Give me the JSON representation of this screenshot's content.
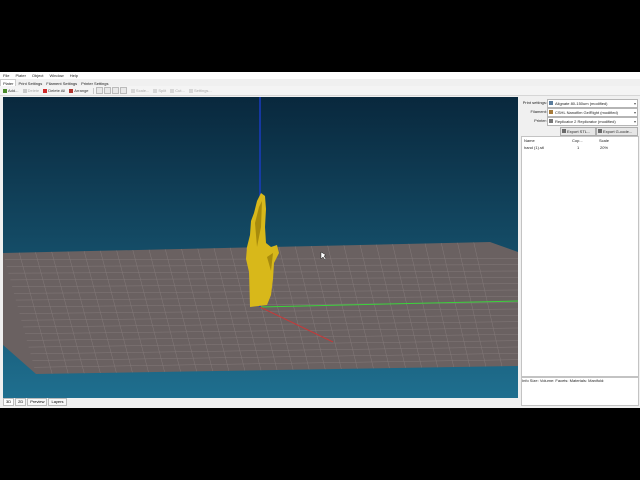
{
  "menu": [
    "File",
    "Plater",
    "Object",
    "Window",
    "Help"
  ],
  "tabs": [
    "Plater",
    "Print Settings",
    "Filament Settings",
    "Printer Settings"
  ],
  "toolbar": {
    "add": "Add...",
    "delete": "Delete",
    "delete_all": "Delete All",
    "arrange": "Arrange",
    "scale": "Scale...",
    "split": "Split",
    "cut": "Cut...",
    "settings": "Settings..."
  },
  "view_tabs": [
    "3D",
    "2D",
    "Preview",
    "Layers"
  ],
  "panel": {
    "print_settings_label": "Print settings:",
    "print_settings_value": "Alignate 80-150um (modified)",
    "filament_label": "Filament:",
    "filament_value": "CSHL Nanofilm GelRight (modified)",
    "printer_label": "Printer:",
    "printer_value": "Replicator 2 Replicrator (modified)",
    "export_stl": "Export STL...",
    "export_gcode": "Export G-code...",
    "columns": [
      "Name",
      "Cop...",
      "Scale"
    ],
    "rows": [
      {
        "name": "hand (1).stl",
        "copies": "1",
        "scale": "20%"
      }
    ],
    "info": {
      "title": "Info",
      "size": "Size:",
      "volume": "Volume:",
      "facets": "Facets:",
      "materials": "Materials:",
      "manifold": "Manifold:"
    }
  },
  "colors": {
    "sky_top": "#09283d",
    "sky_bottom": "#1f6f8f",
    "bed": "#6a6161",
    "axis_x": "#c43a3a",
    "axis_y": "#3bd23b",
    "axis_z": "#1a3cc8",
    "model": "#d8b81a"
  },
  "icons": {
    "add": "plus-icon",
    "delete": "x-icon",
    "delete_all": "x-red-icon",
    "arrange": "arrange-icon"
  }
}
